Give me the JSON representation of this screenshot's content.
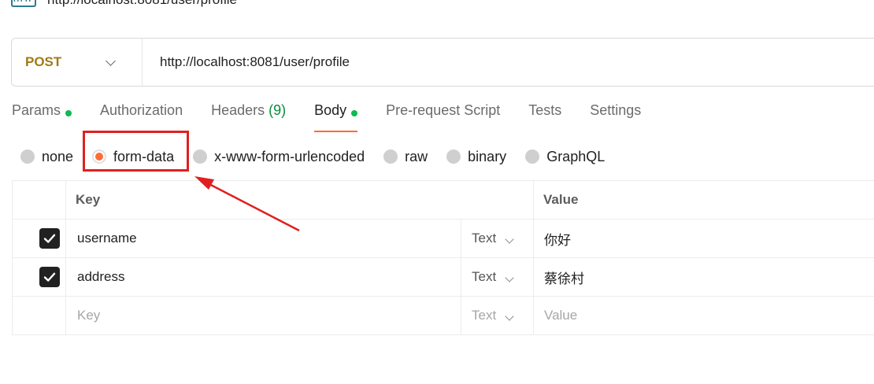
{
  "title": {
    "icon": "http-icon",
    "text": "http://localhost:8081/user/profile"
  },
  "request": {
    "method": "POST",
    "url": "http://localhost:8081/user/profile"
  },
  "tabs": [
    {
      "label": "Params",
      "dot": true
    },
    {
      "label": "Authorization"
    },
    {
      "label": "Headers",
      "count": "(9)"
    },
    {
      "label": "Body",
      "dot": true,
      "active": true
    },
    {
      "label": "Pre-request Script"
    },
    {
      "label": "Tests"
    },
    {
      "label": "Settings"
    }
  ],
  "body_types": [
    {
      "label": "none"
    },
    {
      "label": "form-data",
      "selected": true
    },
    {
      "label": "x-www-form-urlencoded"
    },
    {
      "label": "raw"
    },
    {
      "label": "binary"
    },
    {
      "label": "GraphQL"
    }
  ],
  "table": {
    "headers": {
      "key": "Key",
      "value": "Value"
    },
    "rows": [
      {
        "checked": true,
        "key": "username",
        "type": "Text",
        "value": "你好"
      },
      {
        "checked": true,
        "key": "address",
        "type": "Text",
        "value": "蔡徐村"
      }
    ],
    "empty_row": {
      "key_placeholder": "Key",
      "type": "Text",
      "value_placeholder": "Value"
    }
  },
  "annotation": {
    "color": "#e02020",
    "target": "form-data"
  },
  "colors": {
    "accent": "#ff6c37",
    "method": "#a07a16",
    "dot": "#0cbb52"
  }
}
